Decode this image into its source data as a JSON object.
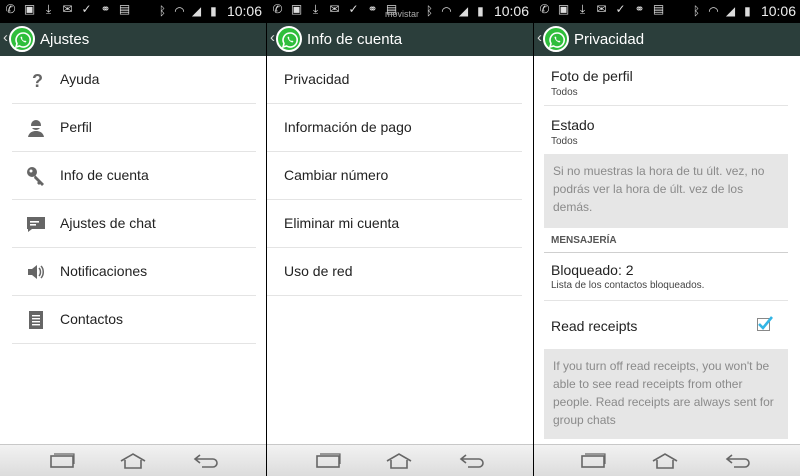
{
  "status_bar": {
    "time": "10:06",
    "carrier": "movistar",
    "icons_left": [
      "whatsapp-notification-icon",
      "image-icon",
      "download-icon",
      "mail-icon",
      "check-icon",
      "link-icon",
      "briefcase-icon"
    ],
    "icons_right": [
      "bluetooth-icon",
      "wifi-icon",
      "signal-icon",
      "battery-icon"
    ]
  },
  "panel1": {
    "title": "Ajustes",
    "items": [
      {
        "label": "Ayuda",
        "icon": "help-icon"
      },
      {
        "label": "Perfil",
        "icon": "person-icon"
      },
      {
        "label": "Info de cuenta",
        "icon": "key-icon"
      },
      {
        "label": "Ajustes de chat",
        "icon": "chat-icon"
      },
      {
        "label": "Notificaciones",
        "icon": "speaker-icon"
      },
      {
        "label": "Contactos",
        "icon": "contacts-icon"
      }
    ]
  },
  "panel2": {
    "title": "Info de cuenta",
    "items": [
      {
        "label": "Privacidad"
      },
      {
        "label": "Información de pago"
      },
      {
        "label": "Cambiar número"
      },
      {
        "label": "Eliminar mi cuenta"
      },
      {
        "label": "Uso de red"
      }
    ]
  },
  "panel3": {
    "title": "Privacidad",
    "profile_photo": {
      "title": "Foto de perfil",
      "value": "Todos"
    },
    "status": {
      "title": "Estado",
      "value": "Todos"
    },
    "last_seen_note": "Si no muestras la hora de tu últ. vez, no podrás ver la hora de últ. vez de los demás.",
    "section_messaging": "MENSAJERÍA",
    "blocked": {
      "title": "Bloqueado: 2",
      "subtitle": "Lista de los contactos bloqueados."
    },
    "read_receipts": {
      "label": "Read receipts",
      "checked": true
    },
    "read_receipts_note": "If you turn off read receipts, you won't be able to see read receipts from other people. Read receipts are always sent for group chats"
  },
  "nav_bar": {
    "buttons": [
      "recent-apps-icon",
      "home-icon",
      "back-icon"
    ]
  },
  "colors": {
    "action_bar": "#2b3e3b",
    "whatsapp_green": "#2fbe3c",
    "checkbox_blue": "#33b5e5",
    "info_box": "#e6e6e6"
  }
}
